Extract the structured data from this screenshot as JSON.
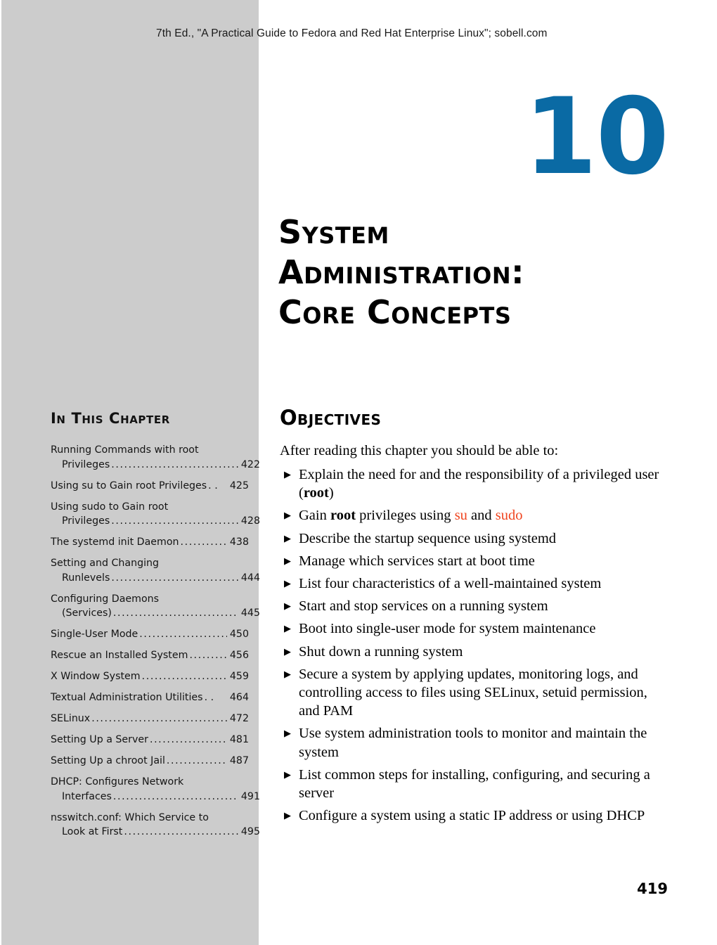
{
  "page": {
    "running_header": "7th Ed., \"A Practical Guide to Fedora and Red Hat Enterprise Linux\"; sobell.com",
    "folio": "419",
    "colors": {
      "sidebar_gray": "#cccccc",
      "chapter_blue": "#0a6aa4",
      "command_orange": "#f0441f",
      "text_black": "#000000"
    }
  },
  "chapter": {
    "number": "10",
    "title_lines": [
      "System",
      "Administration:",
      "Core Concepts"
    ],
    "title_full": "System Administration: Core Concepts"
  },
  "sidebar": {
    "heading": "In This Chapter",
    "entries": [
      {
        "lines": [
          "Running Commands with root",
          "Privileges"
        ],
        "page": "422"
      },
      {
        "lines": [
          "Using su to Gain root Privileges"
        ],
        "page": "425",
        "dots": ". ."
      },
      {
        "lines": [
          "Using sudo to Gain root",
          "Privileges"
        ],
        "page": "428"
      },
      {
        "lines": [
          "The systemd init Daemon"
        ],
        "page": "438"
      },
      {
        "lines": [
          "Setting and Changing",
          "Runlevels"
        ],
        "page": "444"
      },
      {
        "lines": [
          "Configuring Daemons",
          "(Services)"
        ],
        "page": "445"
      },
      {
        "lines": [
          "Single-User Mode"
        ],
        "page": "450"
      },
      {
        "lines": [
          "Rescue an Installed System"
        ],
        "page": "456"
      },
      {
        "lines": [
          "X Window System"
        ],
        "page": "459"
      },
      {
        "lines": [
          "Textual Administration Utilities"
        ],
        "page": "464",
        "dots": ". ."
      },
      {
        "lines": [
          "SELinux"
        ],
        "page": "472"
      },
      {
        "lines": [
          "Setting Up a Server"
        ],
        "page": "481"
      },
      {
        "lines": [
          "Setting Up a chroot Jail"
        ],
        "page": "487"
      },
      {
        "lines": [
          "DHCP: Configures Network",
          "Interfaces"
        ],
        "page": "491"
      },
      {
        "lines": [
          "nsswitch.conf: Which Service to",
          "Look at First"
        ],
        "page": "495"
      }
    ]
  },
  "objectives": {
    "heading": "Objectives",
    "intro": "After reading this chapter you should be able to:",
    "bullet_glyph": "▶",
    "items": [
      {
        "segments": [
          {
            "text": "Explain the need for and the responsibility of a privileged user (",
            "style": "normal"
          },
          {
            "text": "root",
            "style": "bold"
          },
          {
            "text": ")",
            "style": "normal"
          }
        ]
      },
      {
        "segments": [
          {
            "text": "Gain ",
            "style": "normal"
          },
          {
            "text": "root",
            "style": "bold"
          },
          {
            "text": " privileges using ",
            "style": "normal"
          },
          {
            "text": "su",
            "style": "command"
          },
          {
            "text": " and ",
            "style": "normal"
          },
          {
            "text": "sudo",
            "style": "command"
          }
        ]
      },
      {
        "segments": [
          {
            "text": "Describe the startup sequence using systemd",
            "style": "normal"
          }
        ]
      },
      {
        "segments": [
          {
            "text": "Manage which services start at boot time",
            "style": "normal"
          }
        ]
      },
      {
        "segments": [
          {
            "text": "List four characteristics of a well-maintained system",
            "style": "normal"
          }
        ]
      },
      {
        "segments": [
          {
            "text": "Start and stop services on a running system",
            "style": "normal"
          }
        ]
      },
      {
        "segments": [
          {
            "text": "Boot into single-user mode for system maintenance",
            "style": "normal"
          }
        ]
      },
      {
        "segments": [
          {
            "text": "Shut down a running system",
            "style": "normal"
          }
        ]
      },
      {
        "segments": [
          {
            "text": "Secure a system by applying updates, monitoring logs, and controlling access to files using SELinux, setuid permission, and PAM",
            "style": "normal"
          }
        ]
      },
      {
        "segments": [
          {
            "text": "Use system administration tools to monitor and maintain the system",
            "style": "normal"
          }
        ]
      },
      {
        "segments": [
          {
            "text": "List common steps for installing, configuring, and securing a server",
            "style": "normal"
          }
        ]
      },
      {
        "segments": [
          {
            "text": "Configure a system using a static IP address or using DHCP",
            "style": "normal"
          }
        ]
      }
    ]
  }
}
